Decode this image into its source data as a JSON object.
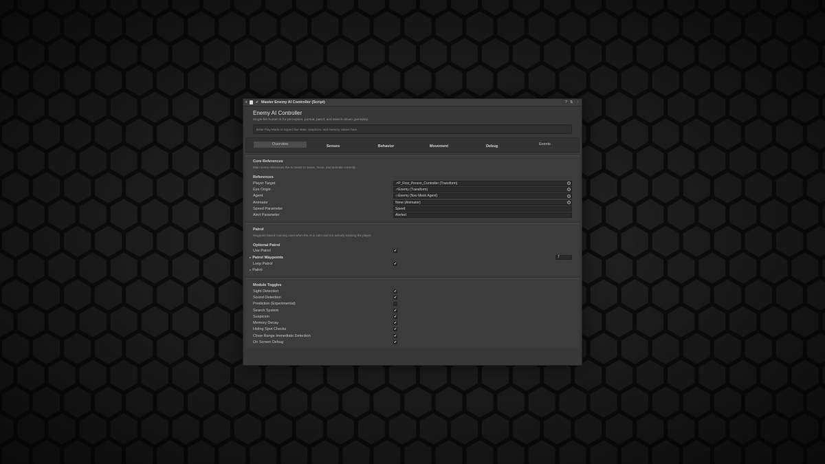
{
  "window": {
    "title": "Master Enemy AI Controller (Script)",
    "help_icon": "?",
    "settings_icon": "⇅",
    "menu_icon": "⋮"
  },
  "header": {
    "title": "Enemy AI Controller",
    "subtitle": "Single-file hunter AI for perception, pursuit, patrol, and search-driven gameplay.",
    "info": "Enter Play Mode to inspect live state, suspicion, and memory values here."
  },
  "tabs": [
    "Overview",
    "Senses",
    "Behavior",
    "Movement",
    "Debug",
    "Events"
  ],
  "core": {
    "title": "Core References",
    "desc": "Main scene references the AI needs to sense, move, and animate correctly.",
    "group": "References",
    "rows": [
      {
        "label": "Player Target",
        "value": "↗P_First_Person_Controller (Transform)"
      },
      {
        "label": "Eye Origin",
        "value": "↗Enemy (Transform)"
      },
      {
        "label": "Agent",
        "value": "⊹Enemy (Nav Mesh Agent)"
      },
      {
        "label": "Animator",
        "value": "None (Animator)"
      },
      {
        "label": "Speed Parameter",
        "value": "Speed"
      },
      {
        "label": "Alert Parameter",
        "value": "Alerted"
      }
    ]
  },
  "patrol": {
    "title": "Patrol",
    "desc": "Waypoint-based roaming used when the AI is calm and not actively tracking the player.",
    "group": "Optional Patrol",
    "use_patrol": "Use Patrol",
    "waypoints": "Patrol Waypoints",
    "waypoint_count": "7",
    "loop_patrol": "Loop Patrol",
    "patrol": "Patrol"
  },
  "modules": {
    "title": "Module Toggles",
    "rows": [
      {
        "label": "Sight Detection",
        "checked": "✔"
      },
      {
        "label": "Sound Detection",
        "checked": "✔"
      },
      {
        "label": "Prediction (Experimental)",
        "checked": ""
      },
      {
        "label": "Search System",
        "checked": "✔"
      },
      {
        "label": "Suspicion",
        "checked": "✔"
      },
      {
        "label": "Memory Decay",
        "checked": "✔"
      },
      {
        "label": "Hiding Spot Checks",
        "checked": "✔"
      },
      {
        "label": "Close Range Immediate Detection",
        "checked": "✔"
      },
      {
        "label": "On Screen Debug",
        "checked": "✔"
      }
    ]
  },
  "check_mark": "✔"
}
